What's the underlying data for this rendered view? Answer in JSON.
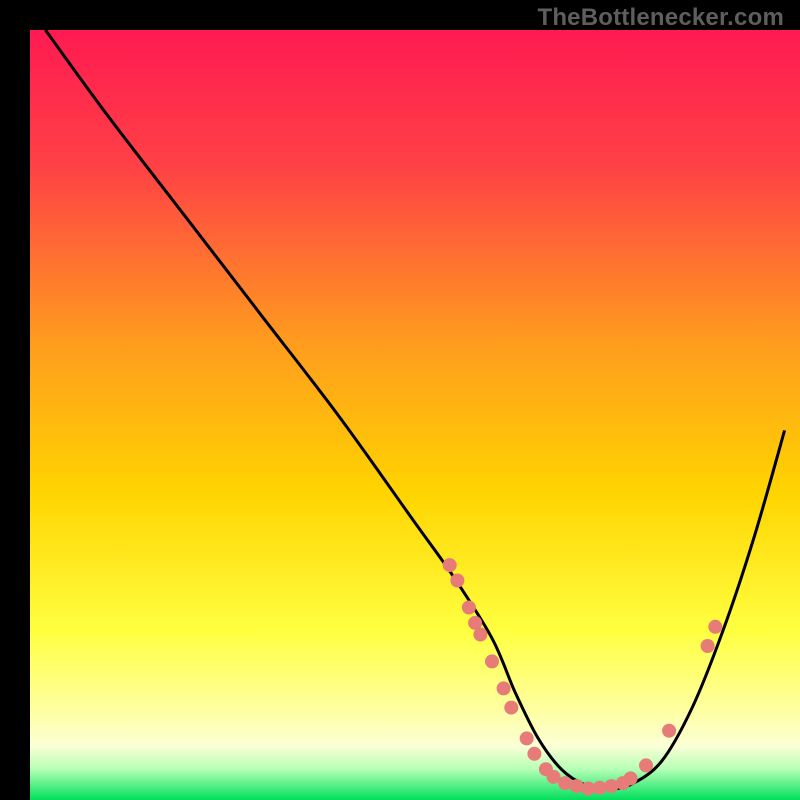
{
  "watermark": "TheBottlenecker.com",
  "chart_data": {
    "type": "line",
    "title": "",
    "xlabel": "",
    "ylabel": "",
    "xlim": [
      0,
      100
    ],
    "ylim": [
      0,
      100
    ],
    "grid": false,
    "legend": false,
    "gradient_stops": [
      {
        "offset": 0,
        "color": "#ff1a52"
      },
      {
        "offset": 18,
        "color": "#ff4245"
      },
      {
        "offset": 40,
        "color": "#ff9a1f"
      },
      {
        "offset": 60,
        "color": "#ffd400"
      },
      {
        "offset": 78,
        "color": "#ffff40"
      },
      {
        "offset": 88,
        "color": "#ffff9e"
      },
      {
        "offset": 93,
        "color": "#fbffd6"
      },
      {
        "offset": 96,
        "color": "#b6ffb6"
      },
      {
        "offset": 100,
        "color": "#00e05c"
      }
    ],
    "series": [
      {
        "name": "bottleneck-curve",
        "color": "#000000",
        "x": [
          2,
          10,
          20,
          30,
          40,
          50,
          55,
          60,
          63,
          66,
          69,
          72,
          75,
          78,
          82,
          86,
          90,
          94,
          98
        ],
        "y": [
          100,
          89,
          76,
          63,
          50,
          36,
          29,
          21,
          14,
          8,
          4,
          2,
          1.5,
          2,
          5,
          12,
          22,
          34,
          48
        ]
      }
    ],
    "scatter_points": {
      "name": "data-markers",
      "color": "#e77b78",
      "radius": 7,
      "points": [
        {
          "x": 54.5,
          "y": 30.5
        },
        {
          "x": 55.5,
          "y": 28.5
        },
        {
          "x": 57.0,
          "y": 25.0
        },
        {
          "x": 57.8,
          "y": 23.0
        },
        {
          "x": 58.5,
          "y": 21.5
        },
        {
          "x": 60.0,
          "y": 18.0
        },
        {
          "x": 61.5,
          "y": 14.5
        },
        {
          "x": 62.5,
          "y": 12.0
        },
        {
          "x": 64.5,
          "y": 8.0
        },
        {
          "x": 65.5,
          "y": 6.0
        },
        {
          "x": 67.0,
          "y": 4.0
        },
        {
          "x": 68.0,
          "y": 3.0
        },
        {
          "x": 69.5,
          "y": 2.2
        },
        {
          "x": 71.0,
          "y": 1.8
        },
        {
          "x": 72.5,
          "y": 1.5
        },
        {
          "x": 74.0,
          "y": 1.6
        },
        {
          "x": 75.5,
          "y": 1.8
        },
        {
          "x": 77.0,
          "y": 2.2
        },
        {
          "x": 78.0,
          "y": 2.8
        },
        {
          "x": 80.0,
          "y": 4.5
        },
        {
          "x": 83.0,
          "y": 9.0
        },
        {
          "x": 88.0,
          "y": 20.0
        },
        {
          "x": 89.0,
          "y": 22.5
        }
      ]
    }
  }
}
